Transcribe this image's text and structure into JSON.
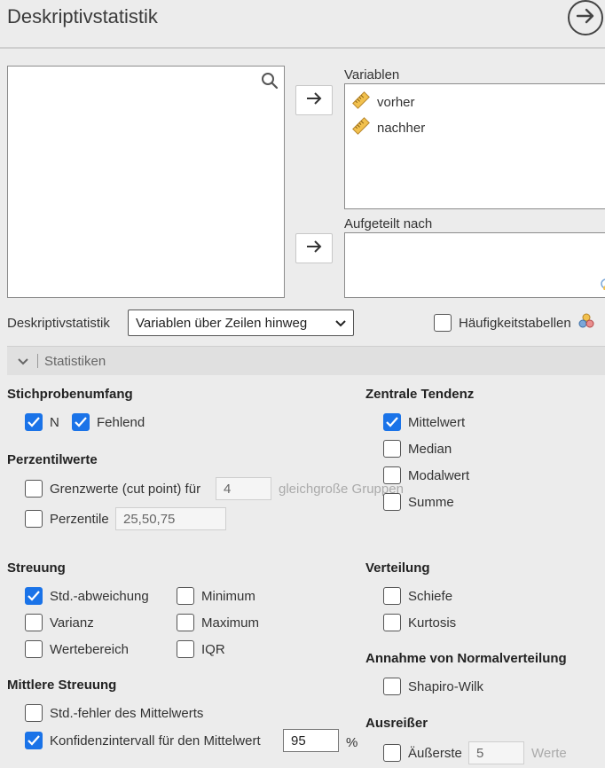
{
  "header": {
    "title": "Deskriptivstatistik",
    "go_icon": "arrow-right-circle-icon"
  },
  "variables": {
    "label": "Variablen",
    "items": [
      {
        "name": "vorher",
        "icon": "ruler-icon"
      },
      {
        "name": "nachher",
        "icon": "ruler-icon"
      }
    ]
  },
  "split": {
    "label": "Aufgeteilt nach"
  },
  "layout_row": {
    "label": "Deskriptivstatistik",
    "select_value": "Variablen über Zeilen hinweg",
    "freq_label": "Häufigkeitstabellen"
  },
  "statistics_section": {
    "label": "Statistiken"
  },
  "sample_size": {
    "heading": "Stichprobenumfang",
    "n_label": "N",
    "n_checked": true,
    "missing_label": "Fehlend",
    "missing_checked": true
  },
  "percentiles": {
    "heading": "Perzentilwerte",
    "cut_label": "Grenzwerte (cut point) für",
    "cut_value": "4",
    "cut_suffix": "gleichgroße Gruppen",
    "perc_label": "Perzentile",
    "perc_value": "25,50,75"
  },
  "central": {
    "heading": "Zentrale Tendenz",
    "items": [
      {
        "label": "Mittelwert",
        "checked": true
      },
      {
        "label": "Median",
        "checked": false
      },
      {
        "label": "Modalwert",
        "checked": false
      },
      {
        "label": "Summe",
        "checked": false
      }
    ]
  },
  "dispersion": {
    "heading": "Streuung",
    "sd": "Std.-abweichung",
    "sd_checked": true,
    "variance": "Varianz",
    "range": "Wertebereich",
    "min": "Minimum",
    "max": "Maximum",
    "iqr": "IQR"
  },
  "distribution": {
    "heading": "Verteilung",
    "skew": "Schiefe",
    "kurt": "Kurtosis"
  },
  "normality": {
    "heading": "Annahme von Normalverteilung",
    "shapiro": "Shapiro-Wilk"
  },
  "mean_dispersion": {
    "heading": "Mittlere Streuung",
    "se": "Std.-fehler des Mittelwerts",
    "ci": "Konfidenzintervall für den Mittelwert",
    "ci_checked": true,
    "ci_value": "95",
    "ci_unit": "%"
  },
  "outliers": {
    "heading": "Ausreißer",
    "extreme": "Äußerste",
    "extreme_value": "5",
    "extreme_unit": "Werte"
  }
}
